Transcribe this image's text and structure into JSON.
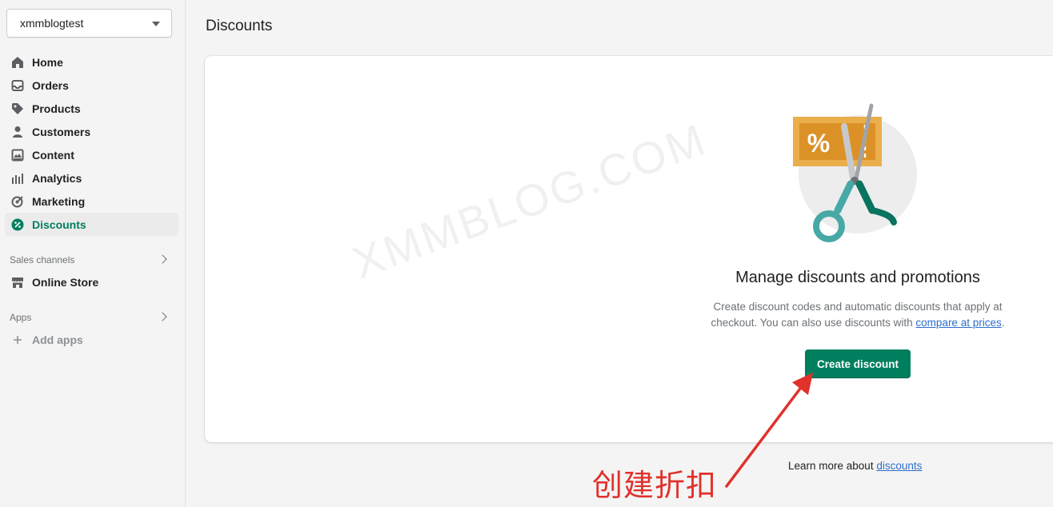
{
  "store_selector": {
    "label": "xmmblogtest"
  },
  "nav": {
    "items": [
      {
        "label": "Home",
        "icon": "home-icon"
      },
      {
        "label": "Orders",
        "icon": "orders-icon"
      },
      {
        "label": "Products",
        "icon": "tag-icon"
      },
      {
        "label": "Customers",
        "icon": "person-icon"
      },
      {
        "label": "Content",
        "icon": "content-icon"
      },
      {
        "label": "Analytics",
        "icon": "bar-chart-icon"
      },
      {
        "label": "Marketing",
        "icon": "target-icon"
      },
      {
        "label": "Discounts",
        "icon": "discount-icon",
        "active": true
      }
    ]
  },
  "sales_channels": {
    "label": "Sales channels",
    "items": [
      {
        "label": "Online Store",
        "icon": "store-icon"
      }
    ]
  },
  "apps": {
    "label": "Apps",
    "add_label": "Add apps"
  },
  "page": {
    "title": "Discounts"
  },
  "watermark": "XMMBLOG.COM",
  "empty_state": {
    "heading": "Manage discounts and promotions",
    "description_before": "Create discount codes and automatic discounts that apply at checkout. You can also use discounts with ",
    "description_link": "compare at prices",
    "description_after": ".",
    "button_label": "Create discount"
  },
  "footer": {
    "text": "Learn more about ",
    "link": "discounts"
  },
  "annotation": {
    "text": "创建折扣"
  },
  "colors": {
    "accent": "#007f5f",
    "link": "#2c6ecb",
    "annotation": "#e0312b"
  }
}
